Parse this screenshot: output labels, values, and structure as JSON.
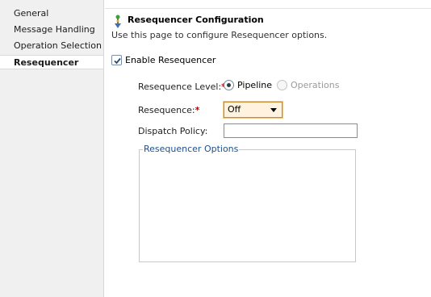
{
  "sidebar": {
    "items": [
      {
        "label": "General",
        "selected": false
      },
      {
        "label": "Message Handling",
        "selected": false
      },
      {
        "label": "Operation Selection",
        "selected": false
      },
      {
        "label": "Resequencer",
        "selected": true
      }
    ]
  },
  "header": {
    "icon": "resequencer-icon",
    "title": "Resequencer  Configuration",
    "description": "Use this page to configure Resequencer options."
  },
  "enable": {
    "label": "Enable Resequencer",
    "checked": true
  },
  "form": {
    "level_label": "Resequence Level:",
    "level_options": [
      {
        "label": "Pipeline",
        "selected": true,
        "disabled": false
      },
      {
        "label": "Operations",
        "selected": false,
        "disabled": true
      }
    ],
    "resequence_label": "Resequence:",
    "resequence_value": "Off",
    "dispatch_label": "Dispatch Policy:",
    "dispatch_value": "",
    "required_marker": "*"
  },
  "options_group": {
    "legend": "Resequencer Options"
  },
  "colors": {
    "sidebar_bg": "#f0f0f0",
    "legend": "#1f4f8a",
    "required": "#c00000",
    "select_border": "#c98a2e"
  }
}
